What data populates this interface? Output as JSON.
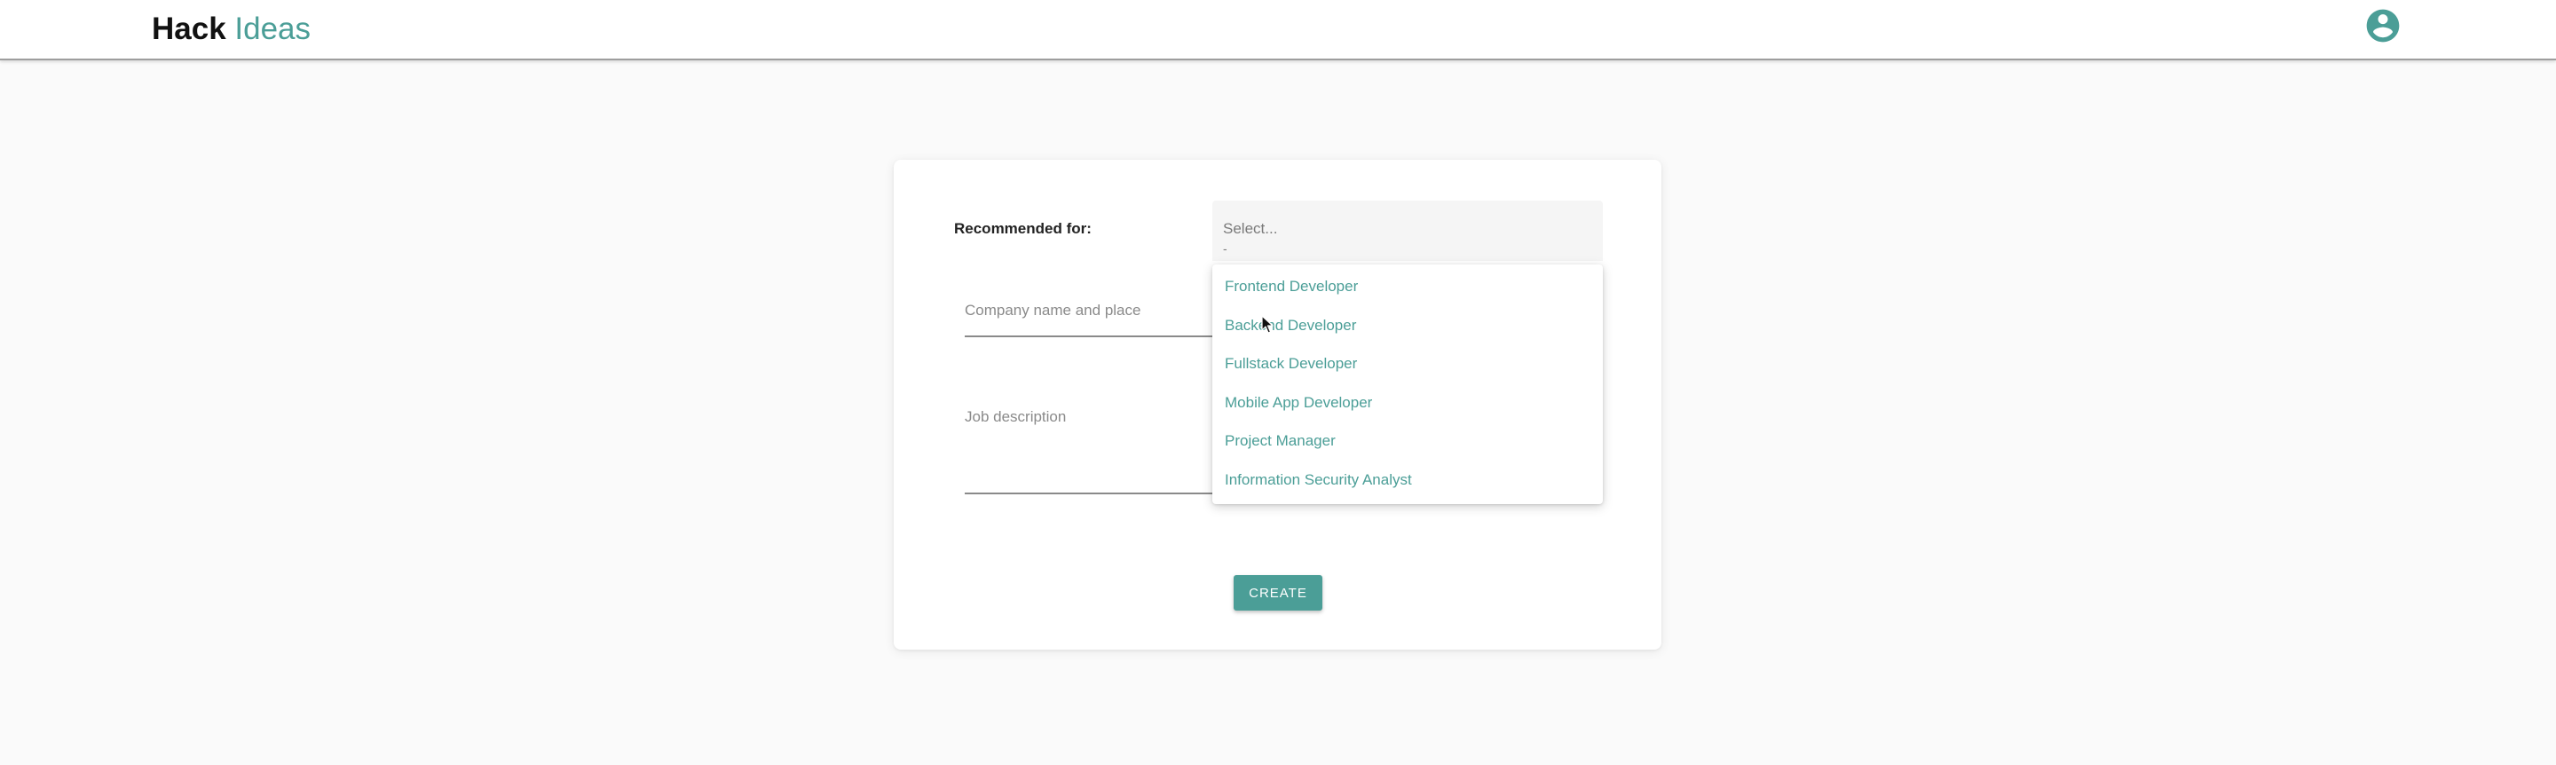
{
  "header": {
    "brand_primary": "Hack",
    "brand_secondary": "Ideas",
    "avatar_icon": "account-circle-icon",
    "accent_color": "#4b9e97"
  },
  "form": {
    "recommended_label": "Recommended for:",
    "select": {
      "placeholder": "Select...",
      "hint": "-",
      "options": [
        "Frontend Developer",
        "Backend Developer",
        "Fullstack Developer",
        "Mobile App Developer",
        "Project Manager",
        "Information Security Analyst"
      ]
    },
    "company_field": {
      "placeholder": "Company name and place",
      "value": ""
    },
    "job_field": {
      "placeholder": "Job description",
      "value": ""
    },
    "create_label": "CREATE"
  }
}
